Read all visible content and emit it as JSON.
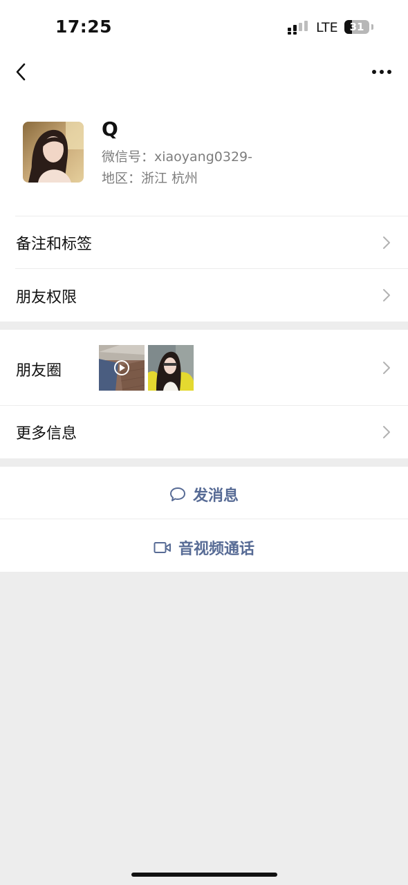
{
  "status_bar": {
    "time": "17:25",
    "network": "LTE",
    "battery_percent": "31",
    "battery_level": 0.31,
    "signal_icon": "signal-bars-icon"
  },
  "nav": {
    "back_icon": "chevron-left-icon",
    "more_icon": "more-dots-icon"
  },
  "profile": {
    "name": "Q",
    "wechat_id": "微信号：xiaoyang0329-",
    "region": "地区：浙江 杭州"
  },
  "menu": {
    "notes_tags": "备注和标签",
    "friend_permissions": "朋友权限",
    "moments": "朋友圈",
    "more_info": "更多信息"
  },
  "actions": {
    "send_message": "发消息",
    "voice_video_call": "音视频通话"
  },
  "colors": {
    "link_blue": "#576b95",
    "background": "#ededed",
    "divider": "#ececec",
    "secondary_text": "#7d7d7d"
  }
}
